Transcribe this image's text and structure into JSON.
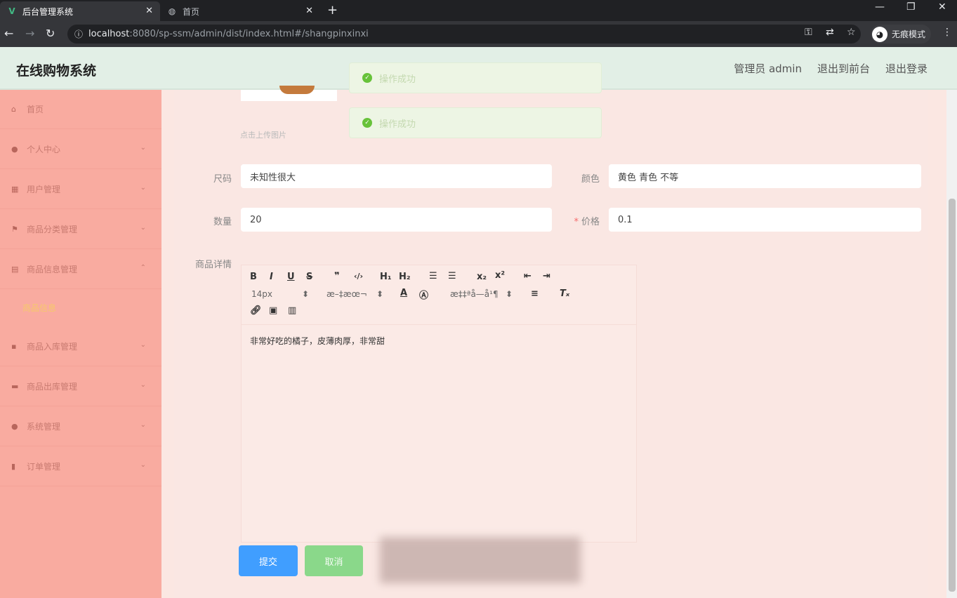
{
  "browser": {
    "tabs": [
      {
        "title": "后台管理系统",
        "active": true
      },
      {
        "title": "首页",
        "active": false
      }
    ],
    "url_host": "localhost",
    "url_path": ":8080/sp-ssm/admin/dist/index.html#/shangpinxinxi",
    "incognito_label": "无痕模式"
  },
  "header": {
    "title": "在线购物系统",
    "links": [
      "管理员 admin",
      "退出到前台",
      "退出登录"
    ]
  },
  "sidebar": {
    "items": [
      {
        "label": "首页",
        "icon": "home-icon"
      },
      {
        "label": "个人中心",
        "icon": "user-icon"
      },
      {
        "label": "用户管理",
        "icon": "users-icon"
      },
      {
        "label": "商品分类管理",
        "icon": "category-icon"
      },
      {
        "label": "商品信息管理",
        "icon": "goods-icon"
      },
      {
        "label": "商品入库管理",
        "icon": "stock-in-icon"
      },
      {
        "label": "商品出库管理",
        "icon": "stock-out-icon"
      },
      {
        "label": "系统管理",
        "icon": "system-icon"
      },
      {
        "label": "订单管理",
        "icon": "order-icon"
      }
    ],
    "active_subitem": "商品信息"
  },
  "form": {
    "upload_hint": "点击上传图片",
    "size_label": "尺码",
    "size_value": "未知性很大",
    "color_label": "颜色",
    "color_value": "黄色 青色 不等",
    "quantity_label": "数量",
    "quantity_value": "20",
    "price_label": "价格",
    "price_value": "0.1",
    "detail_label": "商品详情",
    "detail_text": "非常好吃的橘子，皮薄肉厚，非常甜",
    "submit": "提交",
    "cancel": "取消"
  },
  "editor_toolbar": {
    "font_size": "14px",
    "font_family_garbled": "æ–‡æœ¬",
    "align_garbled": "æ‡‡ªå—å¹¶"
  },
  "toasts": [
    "操作成功",
    "操作成功"
  ],
  "colors": {
    "sidebar_bg": "#f9aba0",
    "header_bg": "#e2efe6",
    "main_bg": "#fae7e3",
    "primary": "#409eff",
    "success": "#67c23a"
  }
}
